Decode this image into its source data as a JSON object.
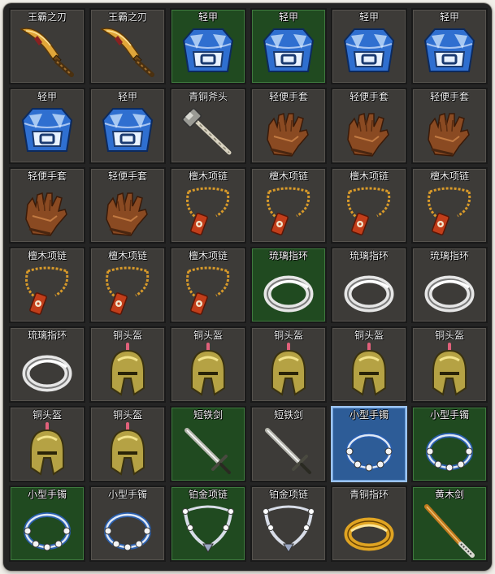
{
  "inventory": {
    "items": [
      {
        "name": "王霸之刃",
        "icon": "great-blade-icon",
        "slot": "normal"
      },
      {
        "name": "王霸之刃",
        "icon": "great-blade-icon",
        "slot": "normal"
      },
      {
        "name": "轻甲",
        "icon": "light-armor-icon",
        "slot": "green"
      },
      {
        "name": "轻甲",
        "icon": "light-armor-icon",
        "slot": "green"
      },
      {
        "name": "轻甲",
        "icon": "light-armor-icon",
        "slot": "normal"
      },
      {
        "name": "轻甲",
        "icon": "light-armor-icon",
        "slot": "normal"
      },
      {
        "name": "轻甲",
        "icon": "light-armor-icon",
        "slot": "normal"
      },
      {
        "name": "轻甲",
        "icon": "light-armor-icon",
        "slot": "normal"
      },
      {
        "name": "青铜斧头",
        "icon": "bronze-axe-icon",
        "slot": "normal"
      },
      {
        "name": "轻便手套",
        "icon": "glove-icon",
        "slot": "normal"
      },
      {
        "name": "轻便手套",
        "icon": "glove-icon",
        "slot": "normal"
      },
      {
        "name": "轻便手套",
        "icon": "glove-icon",
        "slot": "normal"
      },
      {
        "name": "轻便手套",
        "icon": "glove-icon",
        "slot": "normal"
      },
      {
        "name": "轻便手套",
        "icon": "glove-icon",
        "slot": "normal"
      },
      {
        "name": "檀木项链",
        "icon": "sandalwood-necklace-icon",
        "slot": "normal"
      },
      {
        "name": "檀木项链",
        "icon": "sandalwood-necklace-icon",
        "slot": "normal"
      },
      {
        "name": "檀木项链",
        "icon": "sandalwood-necklace-icon",
        "slot": "normal"
      },
      {
        "name": "檀木项链",
        "icon": "sandalwood-necklace-icon",
        "slot": "normal"
      },
      {
        "name": "檀木项链",
        "icon": "sandalwood-necklace-icon",
        "slot": "normal"
      },
      {
        "name": "檀木项链",
        "icon": "sandalwood-necklace-icon",
        "slot": "normal"
      },
      {
        "name": "檀木项链",
        "icon": "sandalwood-necklace-icon",
        "slot": "normal"
      },
      {
        "name": "琉璃指环",
        "icon": "glass-ring-icon",
        "slot": "green"
      },
      {
        "name": "琉璃指环",
        "icon": "glass-ring-icon",
        "slot": "normal"
      },
      {
        "name": "琉璃指环",
        "icon": "glass-ring-icon",
        "slot": "normal"
      },
      {
        "name": "琉璃指环",
        "icon": "glass-ring-icon",
        "slot": "normal"
      },
      {
        "name": "铜头盔",
        "icon": "bronze-helmet-icon",
        "slot": "normal"
      },
      {
        "name": "铜头盔",
        "icon": "bronze-helmet-icon",
        "slot": "normal"
      },
      {
        "name": "铜头盔",
        "icon": "bronze-helmet-icon",
        "slot": "normal"
      },
      {
        "name": "铜头盔",
        "icon": "bronze-helmet-icon",
        "slot": "normal"
      },
      {
        "name": "铜头盔",
        "icon": "bronze-helmet-icon",
        "slot": "normal"
      },
      {
        "name": "铜头盔",
        "icon": "bronze-helmet-icon",
        "slot": "normal"
      },
      {
        "name": "铜头盔",
        "icon": "bronze-helmet-icon",
        "slot": "normal"
      },
      {
        "name": "短铁剑",
        "icon": "short-iron-sword-icon",
        "slot": "green"
      },
      {
        "name": "短铁剑",
        "icon": "short-iron-sword-icon",
        "slot": "normal"
      },
      {
        "name": "小型手镯",
        "icon": "small-bracelet-icon",
        "slot": "selected"
      },
      {
        "name": "小型手镯",
        "icon": "small-bracelet-icon",
        "slot": "green"
      },
      {
        "name": "小型手镯",
        "icon": "small-bracelet-icon",
        "slot": "green"
      },
      {
        "name": "小型手镯",
        "icon": "small-bracelet-icon",
        "slot": "normal"
      },
      {
        "name": "铂金项链",
        "icon": "platinum-necklace-icon",
        "slot": "green"
      },
      {
        "name": "铂金项链",
        "icon": "platinum-necklace-icon",
        "slot": "normal"
      },
      {
        "name": "青铜指环",
        "icon": "bronze-ring-icon",
        "slot": "normal"
      },
      {
        "name": "黄木剑",
        "icon": "wooden-sword-icon",
        "slot": "green"
      }
    ]
  }
}
